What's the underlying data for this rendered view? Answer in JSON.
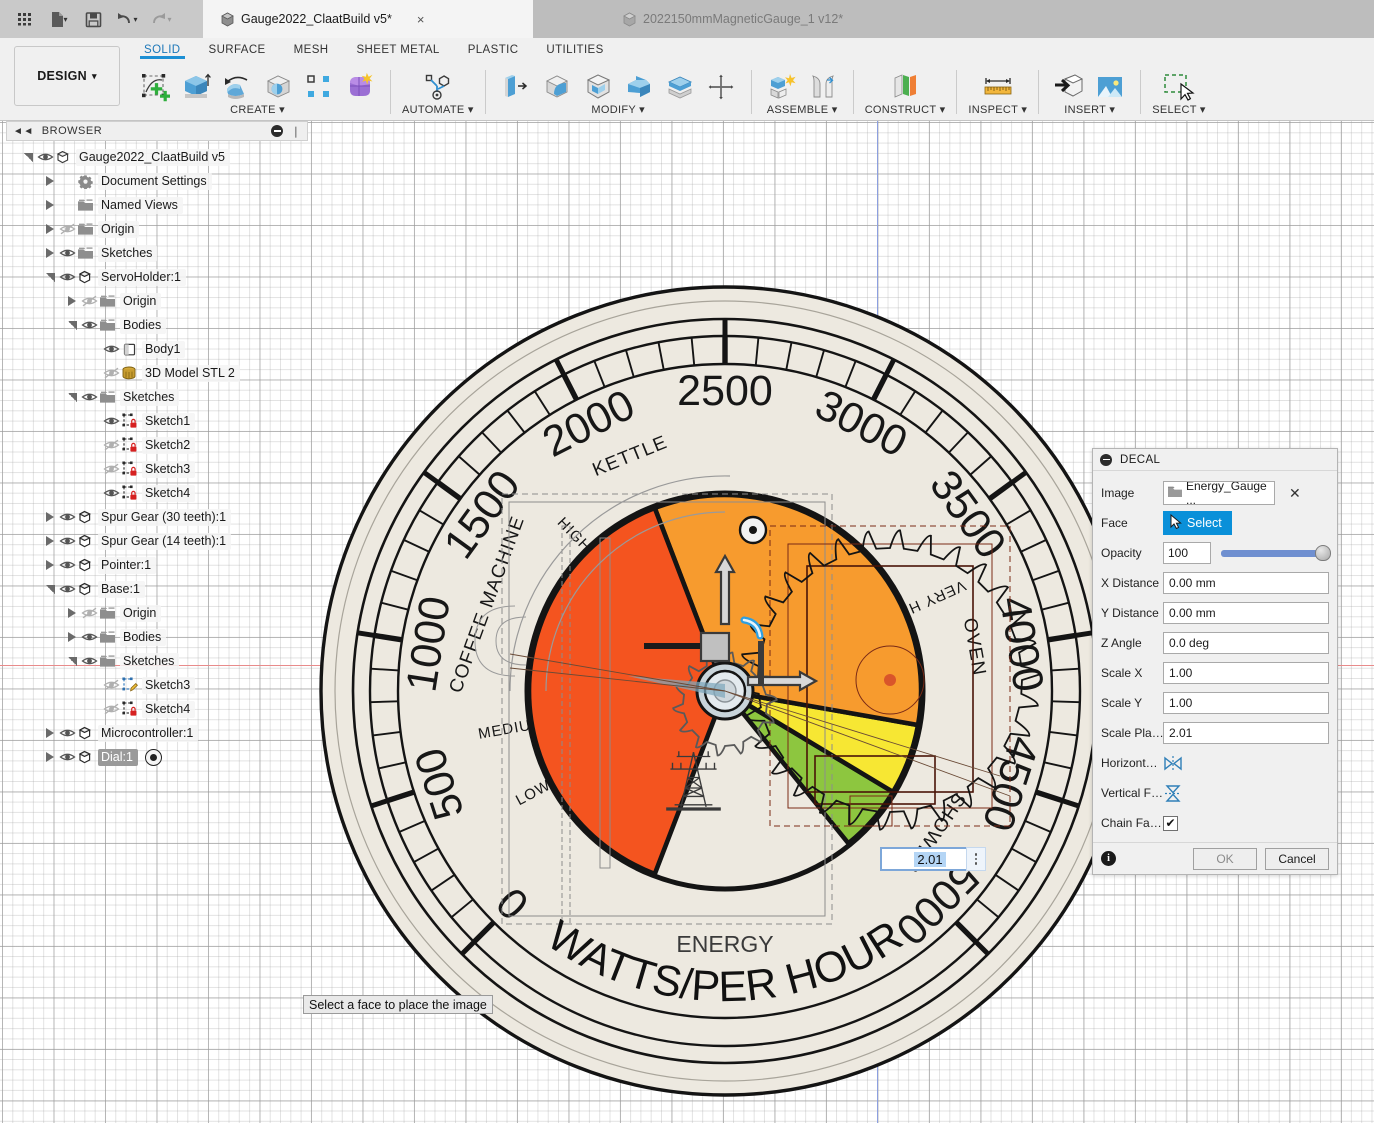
{
  "quick_access": {
    "buttons": [
      {
        "name": "app-grid",
        "label": ""
      },
      {
        "name": "new-file",
        "label": ""
      },
      {
        "name": "save",
        "label": ""
      },
      {
        "name": "undo",
        "label": ""
      },
      {
        "name": "redo",
        "label": ""
      }
    ]
  },
  "tabs": [
    {
      "label": "Gauge2022_ClaatBuild v5*",
      "active": true,
      "close": "×"
    },
    {
      "label": "2022150mmMagneticGauge_1 v12*",
      "active": false
    }
  ],
  "ribbon": {
    "workspace": "DESIGN",
    "workspace_caret": "▾",
    "tabs": [
      {
        "label": "SOLID",
        "selected": true
      },
      {
        "label": "SURFACE",
        "selected": false
      },
      {
        "label": "MESH",
        "selected": false
      },
      {
        "label": "SHEET METAL",
        "selected": false
      },
      {
        "label": "PLASTIC",
        "selected": false
      },
      {
        "label": "UTILITIES",
        "selected": false
      }
    ],
    "panels": [
      {
        "label": "CREATE ▾",
        "icons": [
          "create-sketch-icon",
          "extrude-icon",
          "revolve-icon",
          "sweep-icon",
          "pattern-icon",
          "form-icon"
        ]
      },
      {
        "label": "AUTOMATE ▾",
        "icons": [
          "automate-icon"
        ]
      },
      {
        "label": "MODIFY ▾",
        "icons": [
          "press-pull-icon",
          "fillet-icon",
          "shell-icon",
          "combine-icon",
          "offset-face-icon",
          "move-copy-icon"
        ]
      },
      {
        "label": "ASSEMBLE ▾",
        "icons": [
          "new-component-icon",
          "joint-icon"
        ]
      },
      {
        "label": "CONSTRUCT ▾",
        "icons": [
          "offset-plane-icon"
        ]
      },
      {
        "label": "INSPECT ▾",
        "icons": [
          "measure-icon"
        ]
      },
      {
        "label": "INSERT ▾",
        "icons": [
          "insert-derive-icon",
          "decal-image-icon"
        ]
      },
      {
        "label": "SELECT ▾",
        "icons": [
          "select-window-icon"
        ]
      }
    ]
  },
  "browser": {
    "title": "BROWSER",
    "collapse_icon": "chevron-double-left-icon",
    "minimize_icon": "minus-circle-icon",
    "items": [
      {
        "label": "Gauge2022_ClaatBuild v5",
        "depth": 0,
        "arrow": "open",
        "eye": "visible",
        "icon": "document-icon"
      },
      {
        "label": "Document Settings",
        "depth": 1,
        "arrow": "closed",
        "eye": "none",
        "icon": "gear-icon"
      },
      {
        "label": "Named Views",
        "depth": 1,
        "arrow": "closed",
        "eye": "none",
        "icon": "folder-icon"
      },
      {
        "label": "Origin",
        "depth": 1,
        "arrow": "closed",
        "eye": "hidden",
        "icon": "folder-icon"
      },
      {
        "label": "Sketches",
        "depth": 1,
        "arrow": "closed",
        "eye": "visible",
        "icon": "folder-icon"
      },
      {
        "label": "ServoHolder:1",
        "depth": 1,
        "arrow": "open",
        "eye": "visible",
        "icon": "component-icon"
      },
      {
        "label": "Origin",
        "depth": 2,
        "arrow": "closed",
        "eye": "hidden",
        "icon": "folder-icon"
      },
      {
        "label": "Bodies",
        "depth": 2,
        "arrow": "open",
        "eye": "visible",
        "icon": "folder-icon"
      },
      {
        "label": "Body1",
        "depth": 3,
        "arrow": "none",
        "eye": "visible",
        "icon": "body-icon"
      },
      {
        "label": "3D Model STL 2",
        "depth": 3,
        "arrow": "none",
        "eye": "hidden",
        "icon": "mesh-icon"
      },
      {
        "label": "Sketches",
        "depth": 2,
        "arrow": "open",
        "eye": "visible",
        "icon": "folder-icon"
      },
      {
        "label": "Sketch1",
        "depth": 3,
        "arrow": "none",
        "eye": "visible",
        "icon": "sketch-locked-icon"
      },
      {
        "label": "Sketch2",
        "depth": 3,
        "arrow": "none",
        "eye": "hidden",
        "icon": "sketch-locked-icon"
      },
      {
        "label": "Sketch3",
        "depth": 3,
        "arrow": "none",
        "eye": "hidden",
        "icon": "sketch-locked-icon"
      },
      {
        "label": "Sketch4",
        "depth": 3,
        "arrow": "none",
        "eye": "visible",
        "icon": "sketch-locked-icon"
      },
      {
        "label": "Spur Gear (30 teeth):1",
        "depth": 1,
        "arrow": "closed",
        "eye": "visible",
        "icon": "component-icon"
      },
      {
        "label": "Spur Gear (14 teeth):1",
        "depth": 1,
        "arrow": "closed",
        "eye": "visible",
        "icon": "component-icon"
      },
      {
        "label": "Pointer:1",
        "depth": 1,
        "arrow": "closed",
        "eye": "visible",
        "icon": "component-icon"
      },
      {
        "label": "Base:1",
        "depth": 1,
        "arrow": "open",
        "eye": "visible",
        "icon": "component-icon"
      },
      {
        "label": "Origin",
        "depth": 2,
        "arrow": "closed",
        "eye": "hidden",
        "icon": "folder-icon"
      },
      {
        "label": "Bodies",
        "depth": 2,
        "arrow": "closed",
        "eye": "visible",
        "icon": "folder-icon"
      },
      {
        "label": "Sketches",
        "depth": 2,
        "arrow": "open",
        "eye": "visible",
        "icon": "folder-icon"
      },
      {
        "label": "Sketch3",
        "depth": 3,
        "arrow": "none",
        "eye": "hidden",
        "icon": "sketch-edit-icon"
      },
      {
        "label": "Sketch4",
        "depth": 3,
        "arrow": "none",
        "eye": "hidden",
        "icon": "sketch-locked-icon"
      },
      {
        "label": "Microcontroller:1",
        "depth": 1,
        "arrow": "closed",
        "eye": "visible",
        "icon": "component-icon"
      },
      {
        "label": "Dial:1",
        "depth": 1,
        "arrow": "closed",
        "eye": "visible",
        "icon": "component-icon",
        "selected": true,
        "trailing": "activate-icon"
      }
    ]
  },
  "decal_dialog": {
    "title": "DECAL",
    "image_label": "Image",
    "image_value": "Energy_Gauge ...",
    "image_clear": "✕",
    "face_label": "Face",
    "face_button": "Select",
    "opacity_label": "Opacity",
    "opacity_value": "100",
    "x_distance_label": "X Distance",
    "x_distance_value": "0.00 mm",
    "y_distance_label": "Y Distance",
    "y_distance_value": "0.00 mm",
    "z_angle_label": "Z Angle",
    "z_angle_value": "0.0 deg",
    "scale_x_label": "Scale X",
    "scale_x_value": "1.00",
    "scale_y_label": "Scale Y",
    "scale_y_value": "1.00",
    "scale_plane_label": "Scale Pla…",
    "scale_plane_value": "2.01",
    "horizontal_label": "Horizont…",
    "vertical_label": "Vertical F…",
    "chain_label": "Chain Fa…",
    "chain_checked": "✔",
    "ok_label": "OK",
    "cancel_label": "Cancel",
    "accent_color": "#0a90d9"
  },
  "canvas": {
    "tooltip": "Select a face to place the image",
    "dimension_value": "2.01"
  },
  "gauge": {
    "title_small": "ENERGY",
    "title_big": "WATTS/PER HOUR",
    "tower_icon": "power-pylon-icon",
    "major_ticks": [
      {
        "value": "0",
        "angle": -135
      },
      {
        "value": "500",
        "angle": -108
      },
      {
        "value": "1000",
        "angle": -81
      },
      {
        "value": "1500",
        "angle": -54
      },
      {
        "value": "2000",
        "angle": -27
      },
      {
        "value": "2500",
        "angle": 0
      },
      {
        "value": "3000",
        "angle": 27
      },
      {
        "value": "3500",
        "angle": 54
      },
      {
        "value": "4000",
        "angle": 81
      },
      {
        "value": "4500",
        "angle": 108
      },
      {
        "value": "5000",
        "angle": 135
      }
    ],
    "appliance_labels": [
      {
        "text": "COFFEE MACHINE",
        "angle": -70
      },
      {
        "text": "KETTLE",
        "angle": -22
      },
      {
        "text": "OVEN",
        "angle": 80
      },
      {
        "text": "SHOWER",
        "angle": 124
      }
    ],
    "level_labels": [
      {
        "text": "LOW",
        "angle": -118
      },
      {
        "text": "MEDIUM",
        "angle": -100
      },
      {
        "text": "HIGH",
        "angle": -44
      },
      {
        "text": "VERY HIGH",
        "angle": 66
      }
    ],
    "sectors": [
      {
        "name": "green",
        "color": "#8DC63F",
        "start": 121,
        "end": 141
      },
      {
        "name": "yellow",
        "color": "#F7E733",
        "start": 100,
        "end": 121
      },
      {
        "name": "orange",
        "color": "#F79B2E",
        "start": -21,
        "end": 100
      },
      {
        "name": "red",
        "color": "#F4541F",
        "start": -159,
        "end": -21
      }
    ],
    "colors": {
      "face": "#EDE9E0",
      "ink": "#171717",
      "grid": "#a0a0a0"
    }
  }
}
